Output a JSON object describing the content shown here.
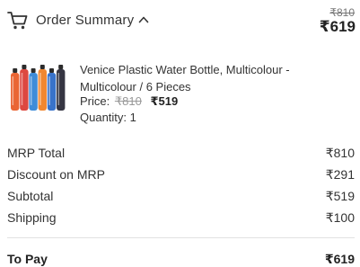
{
  "header": {
    "cart_icon": "shopping-cart-icon",
    "title": "Order Summary",
    "toggle_icon": "chevron-up-icon",
    "mrp": "₹810",
    "total": "₹619"
  },
  "product": {
    "name": "Venice Plastic Water Bottle, Multicolour - Multicolour / 6 Pieces",
    "price_label": "Price:",
    "price_mrp": "₹810",
    "price_sale": "₹519",
    "quantity_text": "Quantity: 1",
    "bottle_colors": [
      "#e8541e",
      "#d9342b",
      "#2a7fd4",
      "#f07a1a",
      "#2464c4",
      "#1f1f2e"
    ]
  },
  "summary": {
    "rows": [
      {
        "label": "MRP Total",
        "value": "₹810"
      },
      {
        "label": "Discount on MRP",
        "value": "₹291"
      },
      {
        "label": "Subtotal",
        "value": "₹519"
      },
      {
        "label": "Shipping",
        "value": "₹100"
      }
    ]
  },
  "to_pay": {
    "label": "To Pay",
    "value": "₹619"
  }
}
